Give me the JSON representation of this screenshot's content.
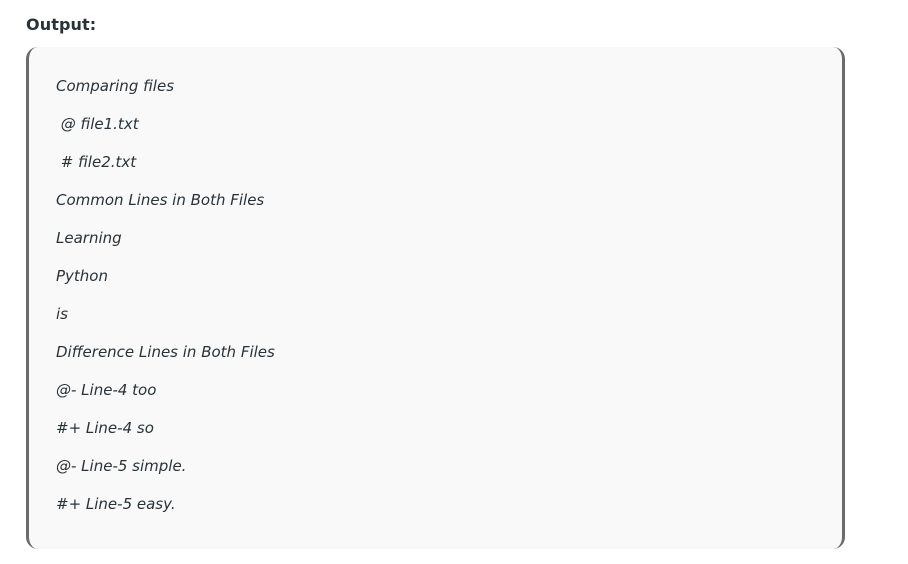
{
  "heading": "Output:",
  "output_lines": [
    "Comparing files",
    " @ file1.txt",
    " # file2.txt",
    "Common Lines in Both Files",
    "Learning",
    "Python",
    "is",
    "Difference Lines in Both Files",
    "@- Line-4 too",
    "#+ Line-4 so",
    "@- Line-5 simple.",
    "#+ Line-5 easy."
  ]
}
